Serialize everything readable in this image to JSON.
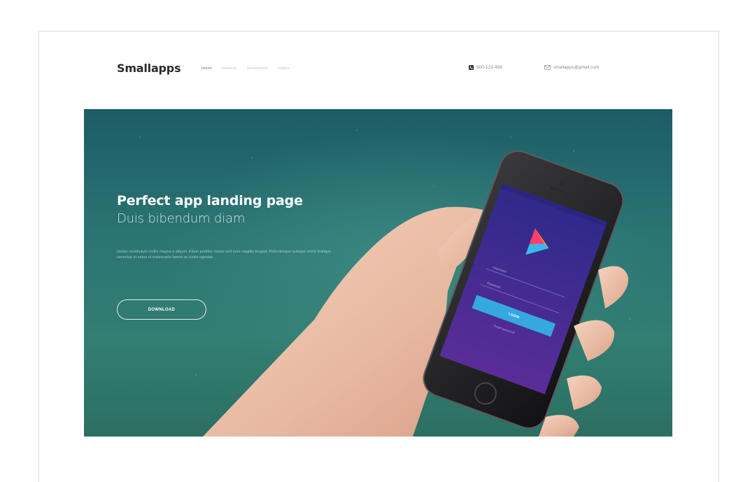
{
  "header": {
    "logo": "Smallapps",
    "nav": [
      "Home",
      "Features",
      "Screenshots",
      "Gallery"
    ],
    "phone": "800-123-456",
    "email": "smallapps@gmail.com"
  },
  "hero": {
    "title": "Perfect app landing page",
    "subtitle": "Duis bibendum diam",
    "body": "Donec vestibulum mollis magna a aliquet. Etiam porttitor metus sed nunc sagittis feugiat. Pellentesque quisque morbi tristique senectus et netus et malesuada fames ac turpis egestas.",
    "download_label": "DOWNLOAD"
  },
  "phone_screen": {
    "username_label": "Username",
    "password_label": "Password",
    "login_label": "LOGIN",
    "forgot_label": "Forgot password?"
  },
  "colors": {
    "hero_gradient_top": "#1d5c66",
    "hero_gradient_bottom": "#2c6f62",
    "screen_purple": "#3b2a8c",
    "login_blue": "#35a8e0"
  },
  "icons": {
    "phone": "phone-icon",
    "email": "mail-icon",
    "app_logo": "app-logo-icon"
  }
}
